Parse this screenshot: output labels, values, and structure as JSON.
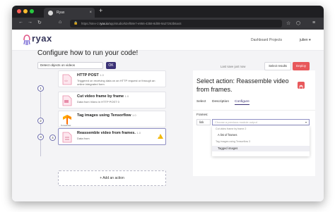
{
  "browser": {
    "tab_title": "Ryax",
    "tab_close": "×",
    "new_tab": "+",
    "url_prefix": "https://stev-2.",
    "url_host": "ryax.io",
    "url_path": "/app/studio/62ef58e7-e956-4358-8d08-9a27263b6a44",
    "icons": [
      "back-icon",
      "forward-icon",
      "reload-icon",
      "home-icon",
      "lock-icon",
      "bookmark-icon",
      "extensions-icon",
      "menu-icon"
    ]
  },
  "nav": {
    "logo_text": "ryax",
    "dashboard": "Dashboard",
    "projects": "Projects",
    "user": "julien ▾"
  },
  "studio": {
    "title": "Configure how to run your code!",
    "select_objects_value": "Detect objects on videos",
    "ok_label": "OK",
    "saved_text": "Last save just now",
    "select_results_label": "Select results",
    "deploy_label": "Deploy",
    "add_action_label": "+  Add an action"
  },
  "steps": [
    {
      "num": "1",
      "title": "HTTP POST",
      "version": "1.0",
      "desc": "Triggered on receiving data on an HTTP request or through an online integrated form",
      "icon": "http-post-icon"
    },
    {
      "num": "2",
      "title": "Cut video frame by frame",
      "version": "1.0",
      "desc": "Data from Video in HTTP POST 0",
      "icon": "video-cut-icon"
    },
    {
      "num": "3",
      "title": "Tag images using Tensorflow",
      "version": "1.0",
      "desc": "",
      "icon": "tensorflow-icon",
      "icon_label": "TensorFlow"
    },
    {
      "num": "4",
      "title": "Reassemble video from frames.",
      "version": "1.0",
      "desc": "Data from",
      "icon": "reassemble-icon",
      "warning": true
    }
  ],
  "panel": {
    "title": "Select action: Reassemble video from frames.",
    "tabs": [
      "Select",
      "Description",
      "Configure"
    ],
    "active_tab": "Configure",
    "frames_label": "Frames:",
    "link_value": "link",
    "choose_placeholder": "Choose a previous module output",
    "dropdown": {
      "group1": "Cut video frame by frame 2",
      "item1": "A list of frames",
      "group2": "Tag images using Tensorflow 3",
      "item2": "Tagged images"
    }
  },
  "colors": {
    "accent": "#3b3276",
    "deploy": "#e8585b",
    "warning": "#f2b705"
  }
}
